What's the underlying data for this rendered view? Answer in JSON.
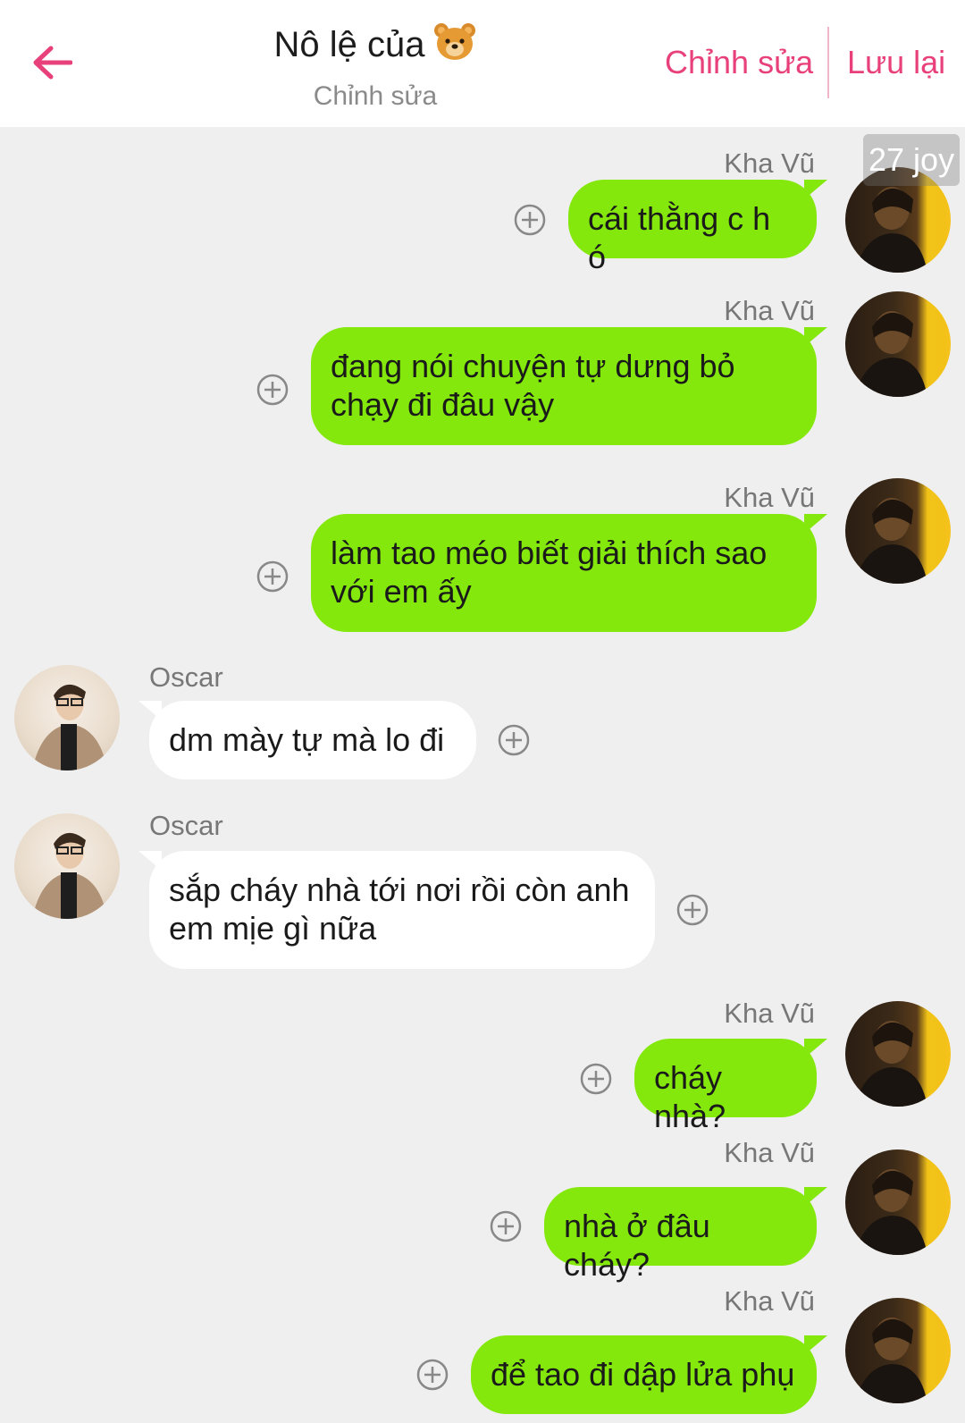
{
  "header": {
    "title": "Nô lệ của",
    "subtitle": "Chỉnh sửa",
    "edit_label": "Chỉnh sửa",
    "save_label": "Lưu lại",
    "accent_color": "#e8407a"
  },
  "watermark": "27 joy",
  "messages": [
    {
      "sender": "Kha Vũ",
      "text": "cái thằng c h ó",
      "side": "out"
    },
    {
      "sender": "Kha Vũ",
      "text": "đang nói chuyện tự dưng bỏ chạy đi đâu vậy",
      "side": "out"
    },
    {
      "sender": "Kha Vũ",
      "text": "làm tao méo biết giải thích sao với em ấy",
      "side": "out"
    },
    {
      "sender": "Oscar",
      "text": "dm mày tự mà lo đi",
      "side": "in"
    },
    {
      "sender": "Oscar",
      "text": "sắp cháy nhà tới nơi rồi còn anh em mịe gì nữa",
      "side": "in"
    },
    {
      "sender": "Kha Vũ",
      "text": "cháy nhà?",
      "side": "out"
    },
    {
      "sender": "Kha Vũ",
      "text": "nhà ở đâu cháy?",
      "side": "out"
    },
    {
      "sender": "Kha Vũ",
      "text": "để tao đi dập lửa phụ",
      "side": "out"
    }
  ],
  "colors": {
    "outgoing_bubble": "#84e80c",
    "incoming_bubble": "#ffffff",
    "background": "#efefef"
  }
}
